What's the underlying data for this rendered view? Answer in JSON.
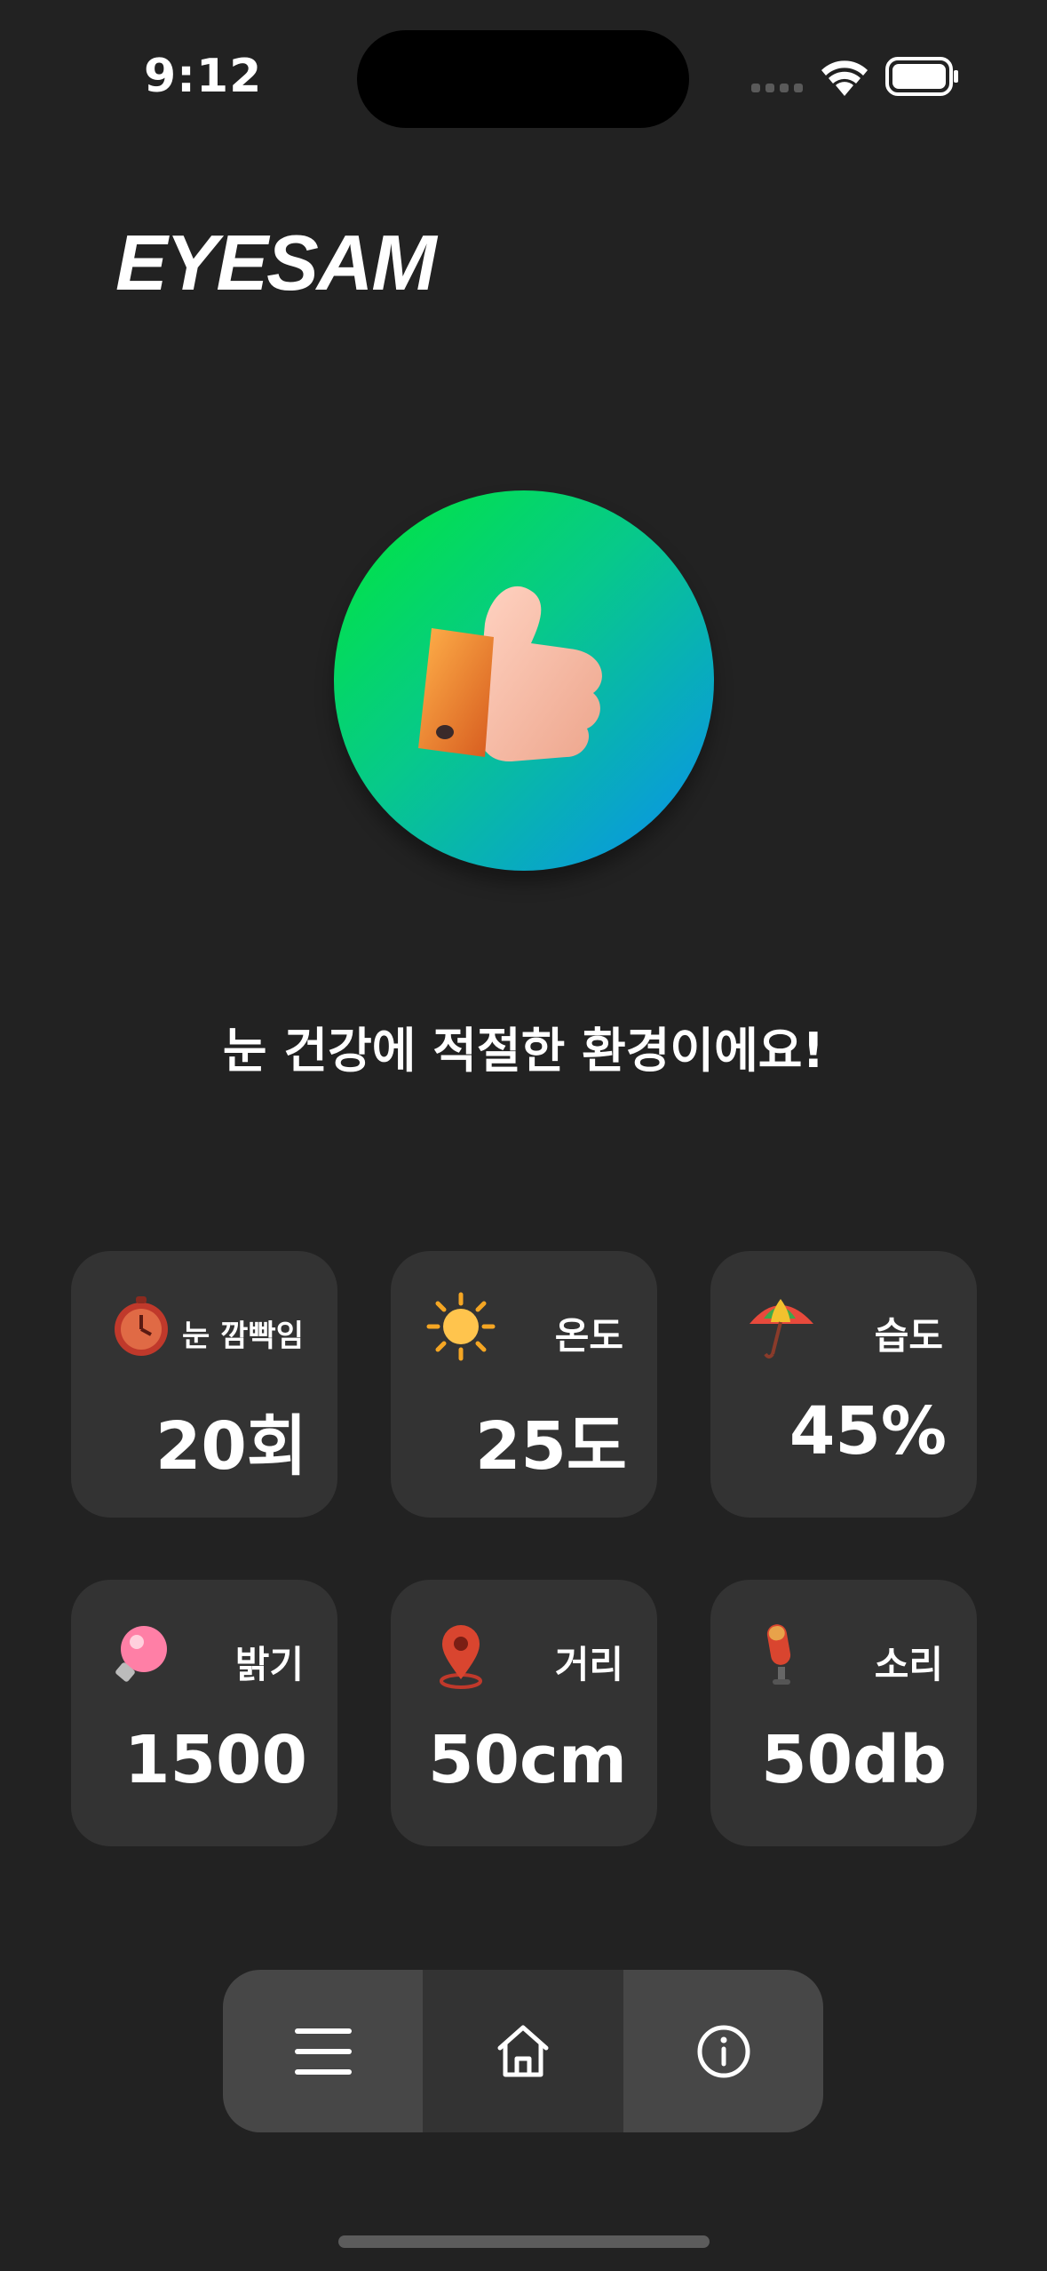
{
  "status_bar": {
    "time": "9:12"
  },
  "app": {
    "title": "EYESAM"
  },
  "hero": {
    "icon": "thumbs-up-icon"
  },
  "message": "눈 건강에 적절한 환경이에요!",
  "metrics": [
    {
      "label": "눈 깜빡임",
      "value": "20회",
      "icon": "stopwatch-icon"
    },
    {
      "label": "온도",
      "value": "25도",
      "icon": "sun-icon"
    },
    {
      "label": "습도",
      "value": "45%",
      "icon": "umbrella-icon"
    },
    {
      "label": "밝기",
      "value": "1500",
      "icon": "lightbulb-icon"
    },
    {
      "label": "거리",
      "value": "50cm",
      "icon": "location-pin-icon"
    },
    {
      "label": "소리",
      "value": "50db",
      "icon": "microphone-icon"
    }
  ],
  "nav": {
    "items": [
      "menu-icon",
      "home-icon",
      "info-icon"
    ]
  },
  "colors": {
    "background": "#222222",
    "card": "#333333",
    "nav_side": "#474747",
    "gradient_start": "#00e83a",
    "gradient_end": "#0a8ff0"
  }
}
